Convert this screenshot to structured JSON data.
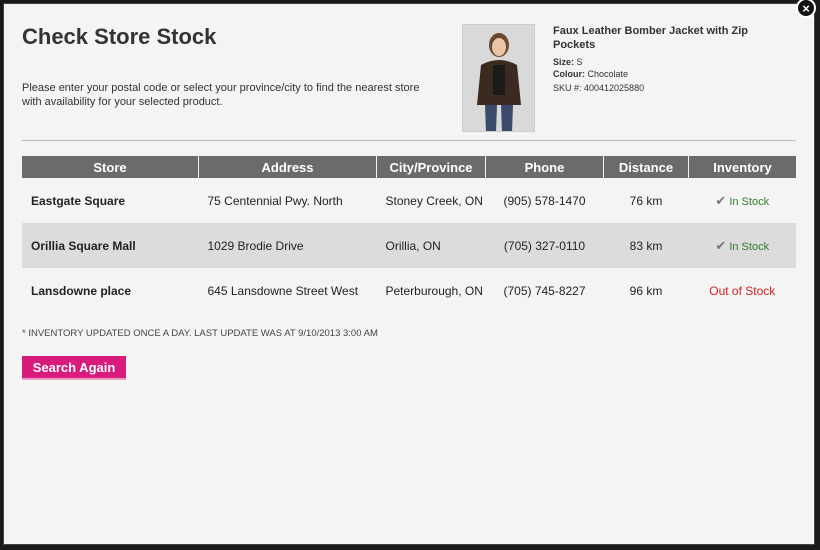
{
  "modal": {
    "title": "Check Store Stock",
    "instructions": "Please enter your postal code or select your province/city to find the nearest store with availability for your selected product.",
    "close_icon": "×"
  },
  "product": {
    "name": "Faux Leather Bomber Jacket with Zip Pockets",
    "size_label": "Size:",
    "size_value": "S",
    "colour_label": "Colour:",
    "colour_value": "Chocolate",
    "sku": "SKU #: 400412025880",
    "image_icon": "product-photo"
  },
  "table": {
    "headers": [
      "Store",
      "Address",
      "City/Province",
      "Phone",
      "Distance",
      "Inventory"
    ],
    "rows": [
      {
        "store": "Eastgate Square",
        "address": "75 Centennial Pwy. North",
        "city": "Stoney Creek, ON",
        "phone": "(905) 578-1470",
        "distance": "76 km",
        "inventory": "In Stock"
      },
      {
        "store": "Orillia Square Mall",
        "address": "1029 Brodie Drive",
        "city": "Orillia, ON",
        "phone": "(705) 327-0110",
        "distance": "83 km",
        "inventory": "In Stock"
      },
      {
        "store": "Lansdowne place",
        "address": "645 Lansdowne Street West",
        "city": "Peterburough, ON",
        "phone": "(705) 745-8227",
        "distance": "96 km",
        "inventory": "Out of Stock"
      }
    ]
  },
  "note": "* INVENTORY UPDATED ONCE A DAY. LAST UPDATE WAS AT 9/10/2013 3:00 AM",
  "search_again_label": "Search Again",
  "colors": {
    "accent": "#d81b7c",
    "header_bg": "#6b6b6b",
    "in_stock": "#2e7d2e",
    "out_of_stock": "#d32020"
  }
}
